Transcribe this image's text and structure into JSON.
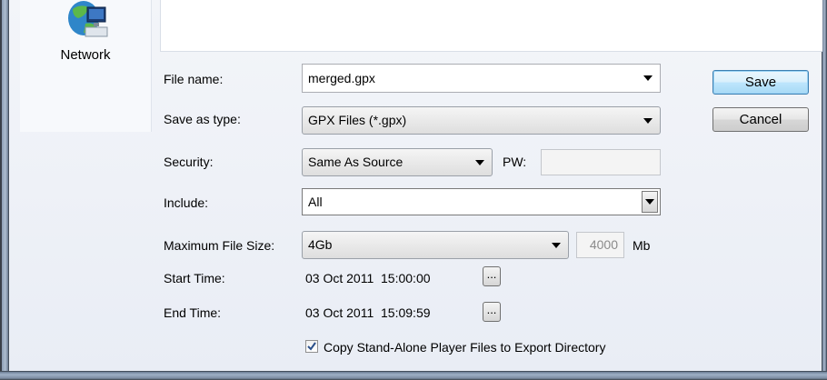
{
  "places": {
    "network_label": "Network"
  },
  "form": {
    "file_name_label": "File name:",
    "file_name_value": "merged.gpx",
    "save_type_label": "Save as type:",
    "save_type_value": "GPX Files (*.gpx)",
    "security_label": "Security:",
    "security_value": "Same As Source",
    "pw_label": "PW:",
    "pw_value": "",
    "include_label": "Include:",
    "include_value": "All",
    "max_size_label": "Maximum File Size:",
    "max_size_value": "4Gb",
    "max_size_number": "4000",
    "max_size_unit": "Mb",
    "start_label": "Start Time:",
    "start_value": "03 Oct 2011  15:00:00",
    "end_label": "End Time:",
    "end_value": "03 Oct 2011  15:09:59",
    "ellipsis": "...",
    "copy_label": "Copy Stand-Alone Player Files to Export Directory",
    "copy_checked": true
  },
  "buttons": {
    "save": "Save",
    "cancel": "Cancel"
  }
}
